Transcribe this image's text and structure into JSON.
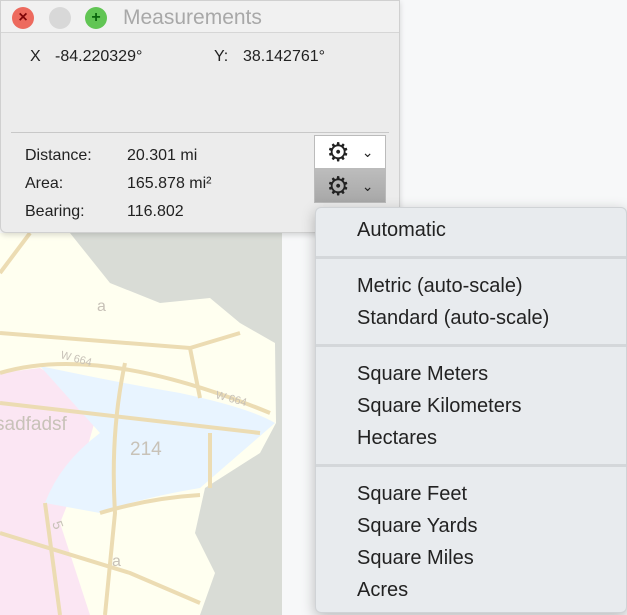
{
  "window": {
    "title": "Measurements"
  },
  "coords": {
    "x_label": "X",
    "x_value": "-84.220329°",
    "y_label": "Y:",
    "y_value": "38.142761°"
  },
  "measurements": [
    {
      "label": "Distance:",
      "value": "20.301 mi"
    },
    {
      "label": "Area:",
      "value": "165.878 mi²"
    },
    {
      "label": "Bearing:",
      "value": "116.802"
    }
  ],
  "menu": {
    "groups": [
      [
        "Automatic"
      ],
      [
        "Metric (auto-scale)",
        "Standard (auto-scale)"
      ],
      [
        "Square Meters",
        "Square Kilometers",
        "Hectares"
      ],
      [
        "Square Feet",
        "Square Yards",
        "Square Miles",
        "Acres"
      ]
    ]
  },
  "map": {
    "labels": [
      "a",
      "W 664",
      "W 664",
      "sadfadsf",
      "214",
      "5",
      "a"
    ]
  }
}
